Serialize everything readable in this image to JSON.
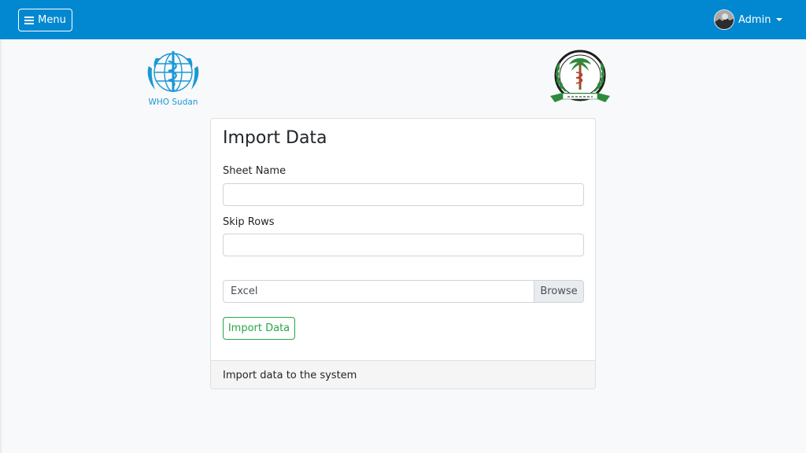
{
  "navbar": {
    "menu_label": "Menu",
    "user_label": "Admin",
    "bg_color": "#0288d1"
  },
  "logos": {
    "who_text": "WHO Sudan"
  },
  "form": {
    "title": "Import Data",
    "sheet_name_label": "Sheet Name",
    "sheet_name_value": "",
    "skip_rows_label": "Skip Rows",
    "skip_rows_value": "",
    "file_label": "Excel",
    "browse_label": "Browse",
    "submit_label": "Import Data",
    "submit_color": "#28a745",
    "footer_text": "Import data to the system"
  }
}
